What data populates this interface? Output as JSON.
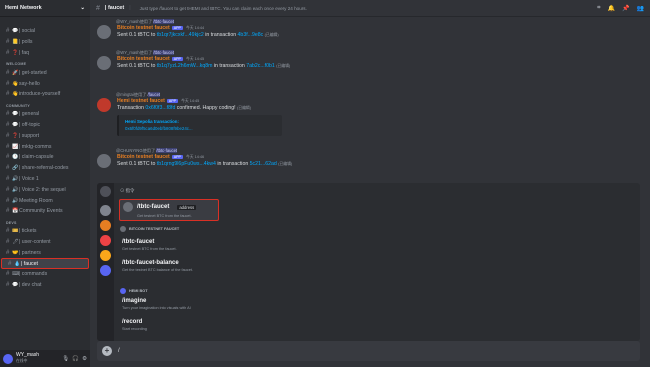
{
  "server": {
    "name": "Hemi Network"
  },
  "channels": [
    {
      "type": "cat",
      "text": ""
    },
    {
      "type": "ch",
      "em": "💬",
      "text": "| social"
    },
    {
      "type": "ch",
      "em": "📒",
      "text": "| polls"
    },
    {
      "type": "ch",
      "em": "❓",
      "text": "| faq"
    },
    {
      "type": "cat",
      "text": "WELCOME"
    },
    {
      "type": "ch",
      "em": "🚀",
      "text": "| get-started"
    },
    {
      "type": "ch",
      "em": "👋",
      "text": "say-hello"
    },
    {
      "type": "ch",
      "em": "👋",
      "text": "introduce-yourself"
    },
    {
      "type": "cat",
      "text": "COMMUNITY"
    },
    {
      "type": "ch",
      "em": "💬",
      "text": "| general"
    },
    {
      "type": "ch",
      "em": "💬",
      "text": "| off-topic"
    },
    {
      "type": "ch",
      "em": "❓",
      "text": "| support"
    },
    {
      "type": "ch",
      "em": "📈",
      "text": "| mktg-comms"
    },
    {
      "type": "ch",
      "em": "🕐",
      "text": "| claim-capsule"
    },
    {
      "type": "ch",
      "em": "🔗",
      "text": "| share-referral-codes"
    },
    {
      "type": "ch",
      "em": "🔊",
      "text": "| Voice 1"
    },
    {
      "type": "ch",
      "em": "🔊",
      "text": "| Voice 2: the sequel"
    },
    {
      "type": "ch",
      "em": "🔊",
      "text": "Meeting Room"
    },
    {
      "type": "ch",
      "em": "📅",
      "text": "Community Events"
    },
    {
      "type": "cat",
      "text": "DEVS"
    },
    {
      "type": "ch",
      "em": "🎫",
      "text": "| tickets"
    },
    {
      "type": "ch",
      "em": "🖊",
      "text": "| user-content"
    },
    {
      "type": "ch",
      "em": "🤝",
      "text": "| partners"
    },
    {
      "type": "ch",
      "em": "💧",
      "text": "| faucet",
      "active": true
    },
    {
      "type": "ch",
      "em": "⌨",
      "text": "| commands"
    },
    {
      "type": "ch",
      "em": "💬",
      "text": "| dev chat"
    }
  ],
  "user": {
    "name": "WY_mash",
    "status": "在线中"
  },
  "topbar": {
    "channel": "| faucet",
    "topic": "Just type /faucet to get tHEMI and tBTC. You can claim each once every 24 hours."
  },
  "messages": [
    {
      "reply_user": "@WY_mash",
      "reply_text": "使用了",
      "reply_cmd": "/tbtc-faucet",
      "author": "Bitcoin testnet faucet",
      "badge": "APP",
      "time": "今天 14:44",
      "text": "Sent 0.1 tBTC to ",
      "addr": "tb1qr7jkcxkf...49kjc2",
      "mid": " in transaction ",
      "tx": "4b3f...9e8c",
      "edited": "(已编辑)"
    },
    {
      "reply_user": "@WY_mash",
      "reply_text": "使用了",
      "reply_cmd": "/tbtc-faucet",
      "author": "Bitcoin testnet faucet",
      "badge": "APP",
      "time": "今天 14:45",
      "text": "Sent 0.1 tBTC to ",
      "addr": "tb1q7yzL2h6mW...kq8m",
      "mid": " in transaction ",
      "tx": "7ab2c...f0b1",
      "edited": "(已编辑)"
    },
    {
      "reply_user": "@mingtai",
      "reply_text": "使用了",
      "reply_cmd": "/faucet",
      "author": "Hemi testnet faucet",
      "badge": "APP",
      "time": "今天 14:45",
      "text": "Transaction ",
      "addr": "0x6f0f3...f8fd",
      "mid": " confirmed. Happy coding! ",
      "tx": "",
      "edited": "(已编辑)",
      "embed_title": "Hemi Sepolia transaction:",
      "embed_link": "0x6f0fd9f5ca6d0ebfb808f9be24c..."
    },
    {
      "reply_user": "@CHUNYING",
      "reply_text": "使用了",
      "reply_cmd": "/tbtc-faucet",
      "author": "Bitcoin testnet faucet",
      "badge": "APP",
      "time": "今天 14:46",
      "text": "Sent 0.1 tBTC to ",
      "addr": "tb1qrng9l6pFu0ws...4kw4",
      "mid": " in transaction ",
      "tx": "5c21...62ad",
      "edited": "(已编辑)"
    }
  ],
  "popup": {
    "header": "指令",
    "selected": {
      "name": "/tbtc-faucet",
      "option": "address",
      "desc": "Get testnet BTC from the faucet."
    },
    "section1": "BITCOIN TESTNET FAUCET",
    "cmds1": [
      {
        "name": "/tbtc-faucet",
        "desc": "Get testnet BTC from the faucet."
      },
      {
        "name": "/tbtc-faucet-balance",
        "desc": "Get the testnet BTC balance of the faucet."
      }
    ],
    "section2": "HEMI BOT",
    "cmds2": [
      {
        "name": "/imagine",
        "desc": "Turn your imagination into visuals with AI"
      },
      {
        "name": "/record",
        "desc": "Start recording"
      }
    ]
  },
  "input": {
    "text": "/"
  },
  "colors": {
    "accent": "#5865f2",
    "highlight": "#d93025",
    "link": "#00a8fc",
    "author": "#e67e22"
  }
}
